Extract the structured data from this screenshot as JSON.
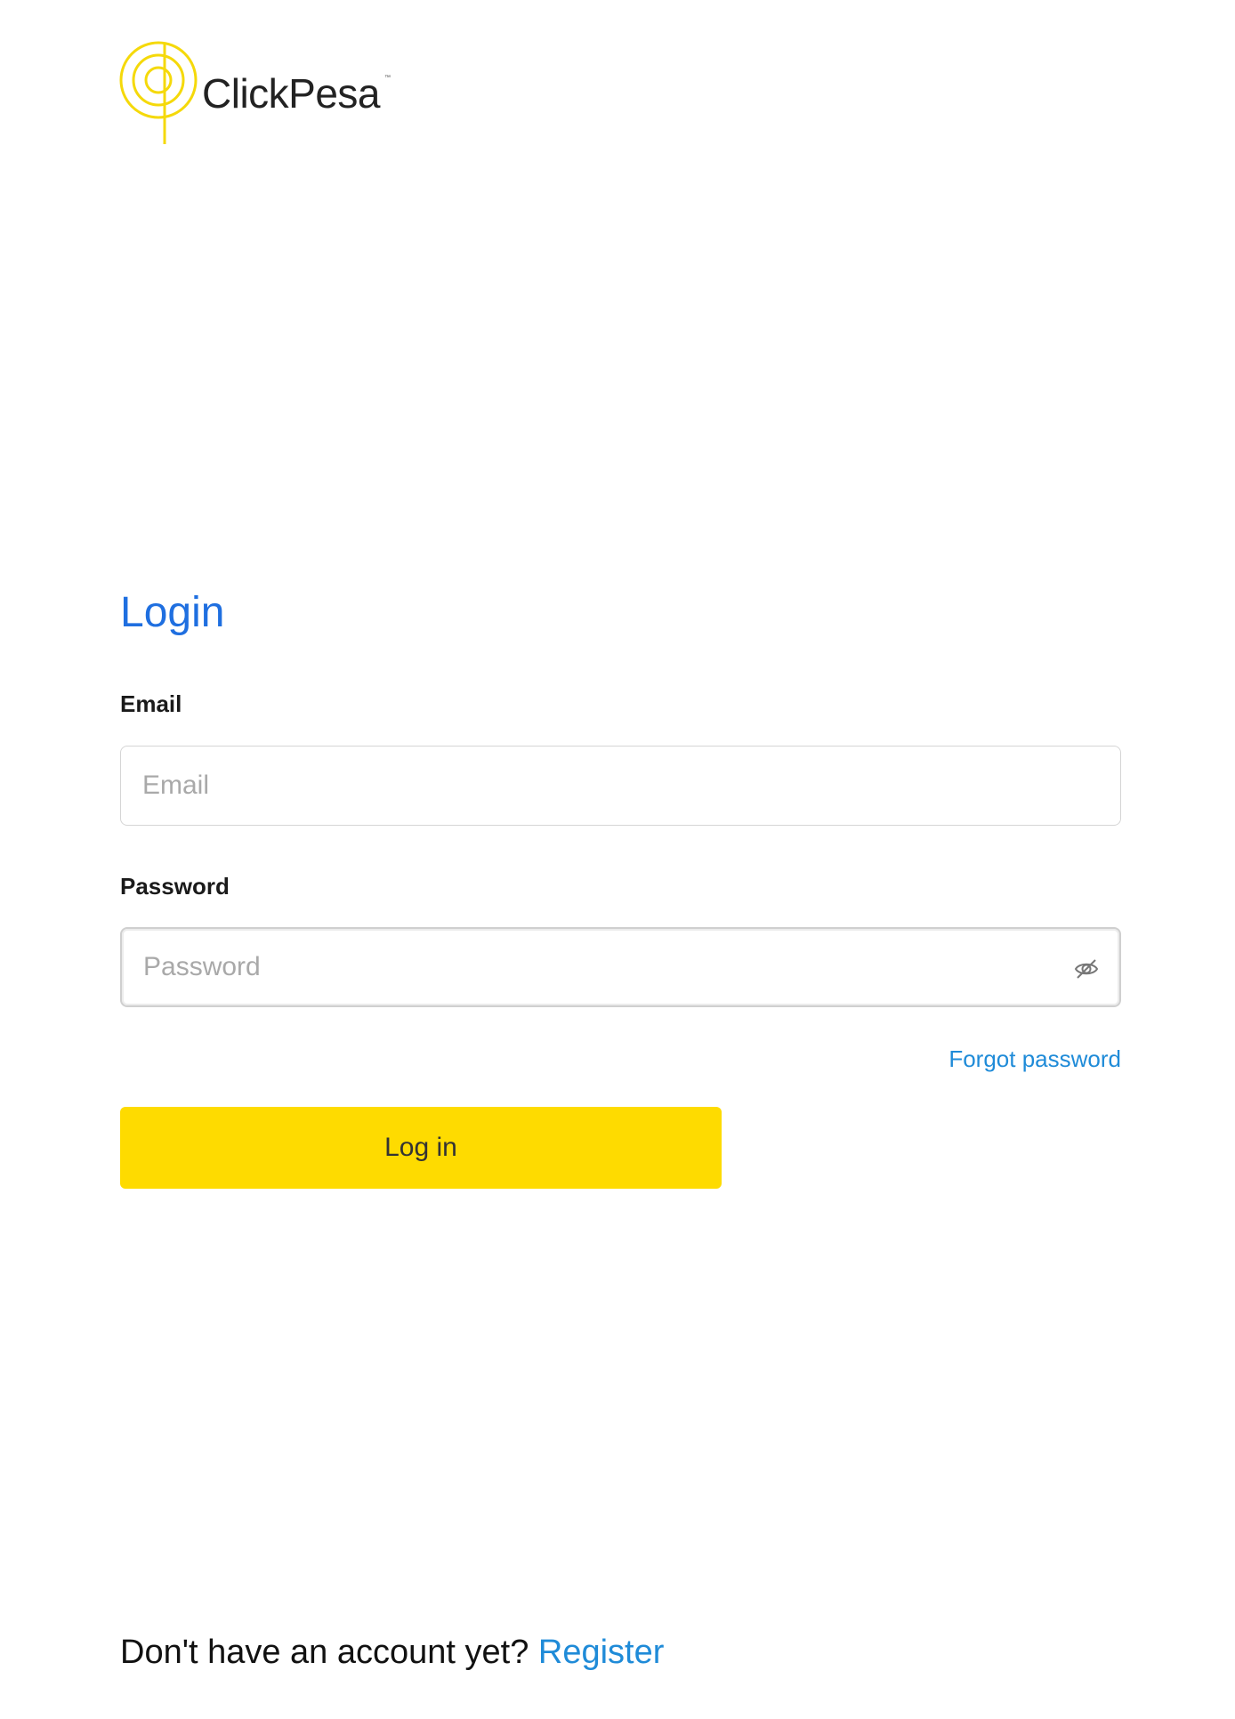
{
  "brand": {
    "name": "ClickPesa",
    "trademark": "™",
    "logo_color": "#f5d90a"
  },
  "login": {
    "title": "Login",
    "email": {
      "label": "Email",
      "placeholder": "Email",
      "value": ""
    },
    "password": {
      "label": "Password",
      "placeholder": "Password",
      "value": "",
      "toggle_icon": "eye-off-icon"
    },
    "forgot_password": "Forgot password",
    "submit_label": "Log in"
  },
  "footer": {
    "prompt": "Don't have an account yet?",
    "register_label": "Register"
  },
  "colors": {
    "accent_blue": "#1f6fe0",
    "link_blue": "#1f8bd8",
    "button_yellow": "#fedb00"
  }
}
